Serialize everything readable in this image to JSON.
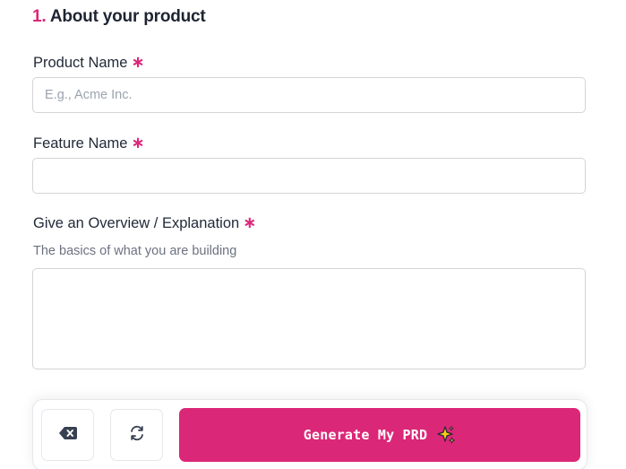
{
  "section": {
    "number": "1.",
    "title": "About your product"
  },
  "fields": {
    "product_name": {
      "label": "Product Name",
      "required_mark": "∗",
      "placeholder": "E.g., Acme Inc.",
      "value": ""
    },
    "feature_name": {
      "label": "Feature Name",
      "required_mark": "∗",
      "placeholder": "",
      "value": ""
    },
    "overview": {
      "label": "Give an Overview / Explanation",
      "required_mark": "∗",
      "hint": "The basics of what you are building",
      "value": ""
    }
  },
  "actions": {
    "clear_icon": "backspace-icon",
    "reset_icon": "refresh-icon",
    "generate_label": "Generate My PRD",
    "generate_icon": "sparkle-icon"
  },
  "colors": {
    "accent": "#db2777",
    "sparkle": "#facc15"
  }
}
